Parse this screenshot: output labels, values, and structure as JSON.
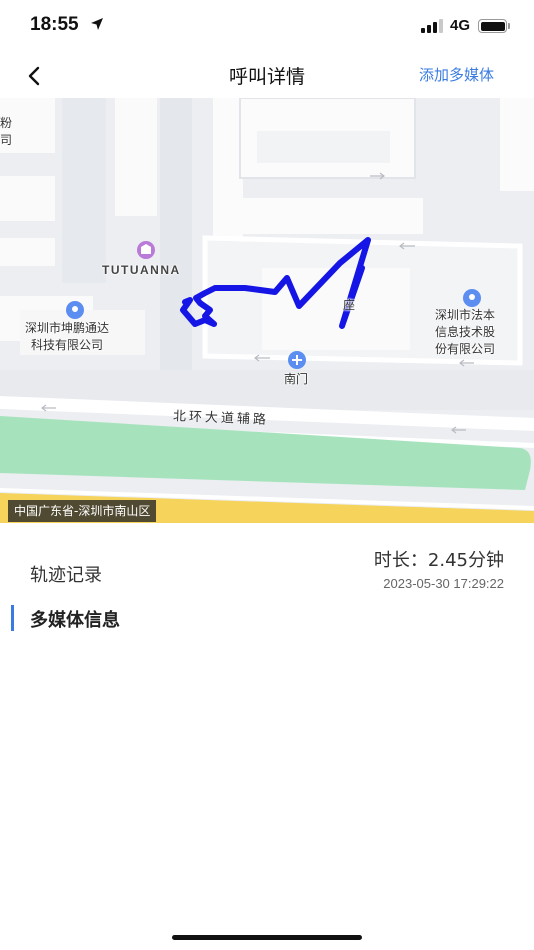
{
  "status_bar": {
    "time": "18:55",
    "network": "4G",
    "icons": [
      "location-arrow-icon",
      "signal-icon",
      "battery-icon"
    ]
  },
  "nav": {
    "title": "呼叫详情",
    "action_label": "添加多媒体",
    "back_icon": "chevron-left-icon",
    "accent_color": "#3a7be0"
  },
  "map": {
    "labels": {
      "tutuanna": "TUTUANNA",
      "kunpeng_line1": "深圳市坤鹏通达",
      "kunpeng_line2": "科技有限公司",
      "faben_line1": "深圳市法本",
      "faben_line2": "信息技术股",
      "faben_line3": "份有限公司",
      "south_gate": "南门",
      "edge_line1": "粉",
      "edge_line2": "司",
      "road": "北环大道辅路",
      "building_partial": "座"
    },
    "address": "中国广东省-深圳市南山区",
    "track_color": "#1515e6",
    "poi_color": "#5b8ef0"
  },
  "track": {
    "label": "轨迹记录",
    "duration": "时长：2.45分钟",
    "timestamp": "2023-05-30 17:29:22"
  },
  "media_section": {
    "title": "多媒体信息"
  }
}
